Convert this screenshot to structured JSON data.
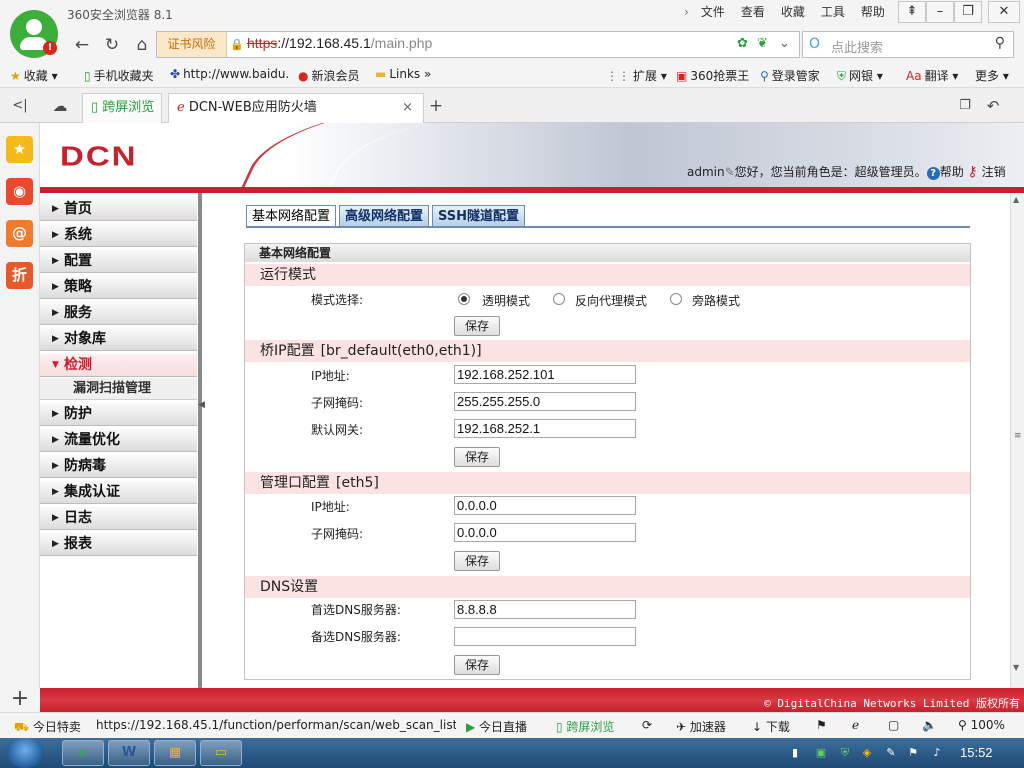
{
  "browser": {
    "window_title": "360安全浏览器 8.1",
    "menu": [
      "文件",
      "查看",
      "收藏",
      "工具",
      "帮助"
    ],
    "cert_warning": "证书风险",
    "url_scheme": "https",
    "url_host": "://192.168.45.1",
    "url_path": "/main.php",
    "search_placeholder": "点此搜索",
    "bookmarks": {
      "favorites": "收藏",
      "mobile": "手机收藏夹",
      "baidu": "http://www.baidu.",
      "sina": "新浪会员",
      "links": "Links",
      "extensions": "扩展",
      "ticket": "360抢票王",
      "login": "登录管家",
      "bank": "网银",
      "translate": "翻译",
      "more": "更多"
    },
    "tabs": {
      "cross_screen": "跨屏浏览",
      "active_tab": "DCN-WEB应用防火墙"
    },
    "status": {
      "today_deal": "今日特卖",
      "hover_url": "https://192.168.45.1/function/performan/scan/web_scan_list.ph",
      "today_live": "今日直播",
      "cross_screen": "跨屏浏览",
      "accelerator": "加速器",
      "download": "下载",
      "zoom": "100%"
    }
  },
  "app": {
    "logo": "DCN",
    "user": "admin",
    "greeting": "您好，您当前角色是：超级管理员。",
    "help": "帮助",
    "logout": "注销",
    "nav": [
      {
        "label": "首页"
      },
      {
        "label": "系统"
      },
      {
        "label": "配置"
      },
      {
        "label": "策略"
      },
      {
        "label": "服务"
      },
      {
        "label": "对象库"
      },
      {
        "label": "检测"
      },
      {
        "label": "防护"
      },
      {
        "label": "流量优化"
      },
      {
        "label": "防病毒"
      },
      {
        "label": "集成认证"
      },
      {
        "label": "日志"
      },
      {
        "label": "报表"
      }
    ],
    "nav_sub": "漏洞扫描管理",
    "content_tabs": [
      "基本网络配置",
      "高级网络配置",
      "SSH隧道配置"
    ],
    "panel_title": "基本网络配置",
    "run_mode": {
      "section": "运行模式",
      "label": "模式选择:",
      "options": [
        "透明模式",
        "反向代理模式",
        "旁路模式"
      ],
      "selected": "透明模式",
      "save": "保存"
    },
    "bridge": {
      "section": "桥IP配置",
      "sub": "[br_default(eth0,eth1)]",
      "ip_label": "IP地址:",
      "ip": "192.168.252.101",
      "mask_label": "子网掩码:",
      "mask": "255.255.255.0",
      "gw_label": "默认网关:",
      "gw": "192.168.252.1",
      "save": "保存"
    },
    "mgmt": {
      "section": "管理口配置",
      "sub": "[eth5]",
      "ip_label": "IP地址:",
      "ip": "0.0.0.0",
      "mask_label": "子网掩码:",
      "mask": "0.0.0.0",
      "save": "保存"
    },
    "dns": {
      "section": "DNS设置",
      "primary_label": "首选DNS服务器:",
      "primary": "8.8.8.8",
      "secondary_label": "备选DNS服务器:",
      "secondary": "",
      "save": "保存"
    },
    "footer": "© DigitalChina Networks Limited 版权所有"
  },
  "taskbar": {
    "clock": "15:52"
  },
  "colors": {
    "brand_red": "#c8202c",
    "section_pink": "#fbe3e3",
    "tab_blue": "#6a8db5",
    "browser_green": "#3dae3a"
  }
}
